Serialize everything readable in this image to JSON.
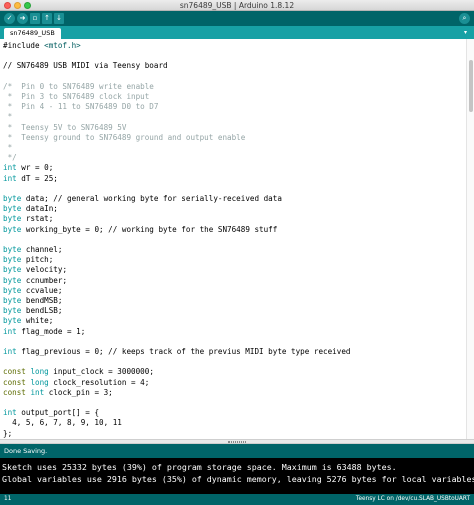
{
  "window": {
    "title": "sn76489_USB | Arduino 1.8.12"
  },
  "toolbar": {
    "buttons": [
      {
        "name": "verify-button",
        "icon": "checkmark-icon",
        "glyph": "✓"
      },
      {
        "name": "upload-button",
        "icon": "arrow-right-icon",
        "glyph": "➜"
      },
      {
        "name": "new-button",
        "icon": "new-file-icon",
        "glyph": "▫"
      },
      {
        "name": "open-button",
        "icon": "arrow-up-icon",
        "glyph": "↑"
      },
      {
        "name": "save-button",
        "icon": "arrow-down-icon",
        "glyph": "↓"
      }
    ],
    "serial_monitor_icon": "magnifier-icon",
    "serial_monitor_glyph": "⌕"
  },
  "tabs": {
    "active": "sn76489_USB",
    "menu_glyph": "▾"
  },
  "editor": {
    "lines": [
      [
        {
          "t": "#include "
        },
        {
          "t": "<mtof.h>",
          "c": "string"
        }
      ],
      [],
      [
        {
          "t": "// SN76489 USB MIDI via Teensy board"
        }
      ],
      [],
      [
        {
          "t": "/*  Pin 0 to SN76489 write enable",
          "c": "comment"
        }
      ],
      [
        {
          "t": " *  Pin 3 to SN76489 clock input",
          "c": "comment"
        }
      ],
      [
        {
          "t": " *  Pin 4 - 11 to SN76489 D0 to D7",
          "c": "comment"
        }
      ],
      [
        {
          "t": " *",
          "c": "comment"
        }
      ],
      [
        {
          "t": " *  Teensy 5V to SN76489 5V",
          "c": "comment"
        }
      ],
      [
        {
          "t": " *  Teensy ground to SN76489 ground and output enable",
          "c": "comment"
        }
      ],
      [
        {
          "t": " *",
          "c": "comment"
        }
      ],
      [
        {
          "t": " */",
          "c": "comment"
        }
      ],
      [
        {
          "t": "int",
          "c": "type"
        },
        {
          "t": " wr = 0;"
        }
      ],
      [
        {
          "t": "int",
          "c": "type"
        },
        {
          "t": " dT = 25;"
        }
      ],
      [],
      [
        {
          "t": "byte",
          "c": "type"
        },
        {
          "t": " data; // general working byte for serially-received data"
        }
      ],
      [
        {
          "t": "byte",
          "c": "type"
        },
        {
          "t": " dataIn;"
        }
      ],
      [
        {
          "t": "byte",
          "c": "type"
        },
        {
          "t": " rstat;"
        }
      ],
      [
        {
          "t": "byte",
          "c": "type"
        },
        {
          "t": " working_byte = 0; // working byte for the SN76489 stuff"
        }
      ],
      [],
      [
        {
          "t": "byte",
          "c": "type"
        },
        {
          "t": " channel;"
        }
      ],
      [
        {
          "t": "byte",
          "c": "type"
        },
        {
          "t": " pitch;"
        }
      ],
      [
        {
          "t": "byte",
          "c": "type"
        },
        {
          "t": " velocity;"
        }
      ],
      [
        {
          "t": "byte",
          "c": "type"
        },
        {
          "t": " ccnumber;"
        }
      ],
      [
        {
          "t": "byte",
          "c": "type"
        },
        {
          "t": " ccvalue;"
        }
      ],
      [
        {
          "t": "byte",
          "c": "type"
        },
        {
          "t": " bendMSB;"
        }
      ],
      [
        {
          "t": "byte",
          "c": "type"
        },
        {
          "t": " bendLSB;"
        }
      ],
      [
        {
          "t": "byte",
          "c": "type"
        },
        {
          "t": " white;"
        }
      ],
      [
        {
          "t": "int",
          "c": "type"
        },
        {
          "t": " flag_mode = 1;"
        }
      ],
      [],
      [
        {
          "t": "int",
          "c": "type"
        },
        {
          "t": " flag_previous = 0; // keeps track of the previus MIDI byte type received"
        }
      ],
      [],
      [
        {
          "t": "const",
          "c": "keyword"
        },
        {
          "t": " "
        },
        {
          "t": "long",
          "c": "type"
        },
        {
          "t": " input_clock = 3000000;"
        }
      ],
      [
        {
          "t": "const",
          "c": "keyword"
        },
        {
          "t": " "
        },
        {
          "t": "long",
          "c": "type"
        },
        {
          "t": " clock_resolution = 4;"
        }
      ],
      [
        {
          "t": "const",
          "c": "keyword"
        },
        {
          "t": " "
        },
        {
          "t": "int",
          "c": "type"
        },
        {
          "t": " clock_pin = 3;"
        }
      ],
      [],
      [
        {
          "t": "int",
          "c": "type"
        },
        {
          "t": " output_port[] = {"
        }
      ],
      [
        {
          "t": "  4, 5, 6, 7, 8, 9, 10, 11"
        }
      ],
      [
        {
          "t": "};"
        }
      ]
    ]
  },
  "editor_scroll_fraction": 0.06,
  "status": {
    "message": "Done Saving."
  },
  "console": {
    "lines": [
      "Sketch uses 25332 bytes (39%) of program storage space. Maximum is 63488 bytes.",
      "Global variables use 2916 bytes (35%) of dynamic memory, leaving 5276 bytes for local variables. Maxi"
    ]
  },
  "footer": {
    "line_number": "11",
    "board": "Teensy LC on /dev/cu.SLAB_USBtoUART"
  },
  "colors": {
    "toolbar": "#006468",
    "tabbar": "#17a1a5",
    "keyword_type": "#00979c",
    "comment": "#95a5a6",
    "console_bg": "#000000"
  }
}
